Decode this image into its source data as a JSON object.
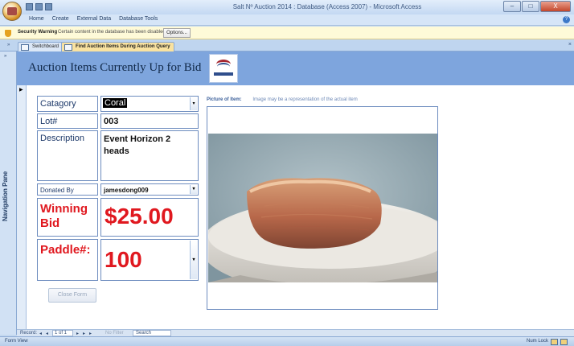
{
  "window": {
    "title": "Salt Nº Auction 2014 : Database (Access 2007) - Microsoft Access",
    "controls": {
      "minimize": "–",
      "maximize": "□",
      "close": "X"
    }
  },
  "ribbon": {
    "tabs": [
      "Home",
      "Create",
      "External Data",
      "Database Tools"
    ]
  },
  "security": {
    "title": "Security Warning",
    "message": "Certain content in the database has been disabled",
    "options_label": "Options..."
  },
  "tabs": [
    {
      "label": "Switchboard",
      "active": false
    },
    {
      "label": "Find Auction Items During Auction Query",
      "active": true
    }
  ],
  "nav_pane": {
    "label": "Navigation Pane"
  },
  "form": {
    "header_title": "Auction Items Currently Up for Bid",
    "fields": {
      "category": {
        "label": "Catagory",
        "value": "Coral"
      },
      "lot": {
        "label": "Lot#",
        "value": "003"
      },
      "description": {
        "label": "Description",
        "value": "Event Horizon 2 heads"
      },
      "donated_by": {
        "label": "Donated By",
        "value": "jamesdong009"
      },
      "winning_bid": {
        "label": "Winning Bid",
        "value": "$25.00"
      },
      "paddle": {
        "label": "Paddle#:",
        "value": "100"
      }
    },
    "close_button_label": "Close Form",
    "picture_label": "Picture of Item:",
    "picture_note": "Image may be a representation of the actual item"
  },
  "record_nav": {
    "record_label": "Record:",
    "position": "1 of 1",
    "filter_label": "No Filter",
    "search_label": "Search"
  },
  "status": {
    "left": "Form View",
    "num_lock": "Num Lock"
  },
  "colors": {
    "header": "#7ea5dd",
    "bid_red": "#e0181f",
    "tab_active": "#f9e2a0"
  }
}
